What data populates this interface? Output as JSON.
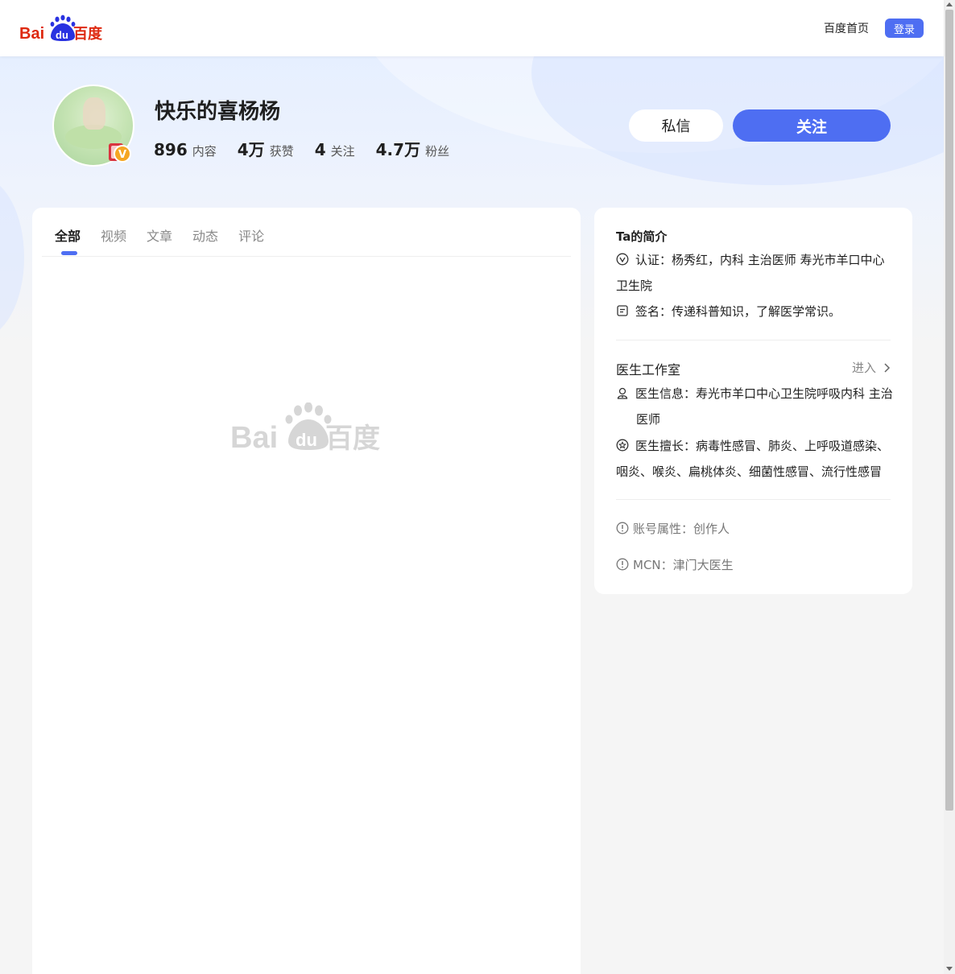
{
  "header": {
    "logo_text_left": "Bai",
    "logo_text_mid": "du",
    "logo_text_right": "百度",
    "home_link": "百度首页",
    "login_button": "登录"
  },
  "profile": {
    "name": "快乐的喜杨杨",
    "stats": [
      {
        "num": "896",
        "label": "内容"
      },
      {
        "num": "4万",
        "label": "获赞"
      },
      {
        "num": "4",
        "label": "关注"
      },
      {
        "num": "4.7万",
        "label": "粉丝"
      }
    ],
    "message_button": "私信",
    "follow_button": "关注",
    "badge_letter": "V"
  },
  "tabs": [
    {
      "label": "全部",
      "active": true
    },
    {
      "label": "视频",
      "active": false
    },
    {
      "label": "文章",
      "active": false
    },
    {
      "label": "动态",
      "active": false
    },
    {
      "label": "评论",
      "active": false
    }
  ],
  "intro": {
    "title": "Ta的简介",
    "certification": "认证：杨秀红，内科 主治医师 寿光市羊口中心卫生院",
    "signature": "签名：传递科普知识，了解医学常识。"
  },
  "studio": {
    "title": "医生工作室",
    "enter_link": "进入",
    "doctor_info": "医生信息：寿光市羊口中心卫生院呼吸内科 主治医师",
    "specialty": "医生擅长：病毒性感冒、肺炎、上呼吸道感染、咽炎、喉炎、扁桃体炎、细菌性感冒、流行性感冒"
  },
  "account": {
    "attribute": "账号属性：创作人",
    "mcn": "MCN：津门大医生"
  },
  "colors": {
    "accent": "#4e6ef2",
    "baidu_red": "#de2910",
    "baidu_blue": "#2932e1"
  }
}
